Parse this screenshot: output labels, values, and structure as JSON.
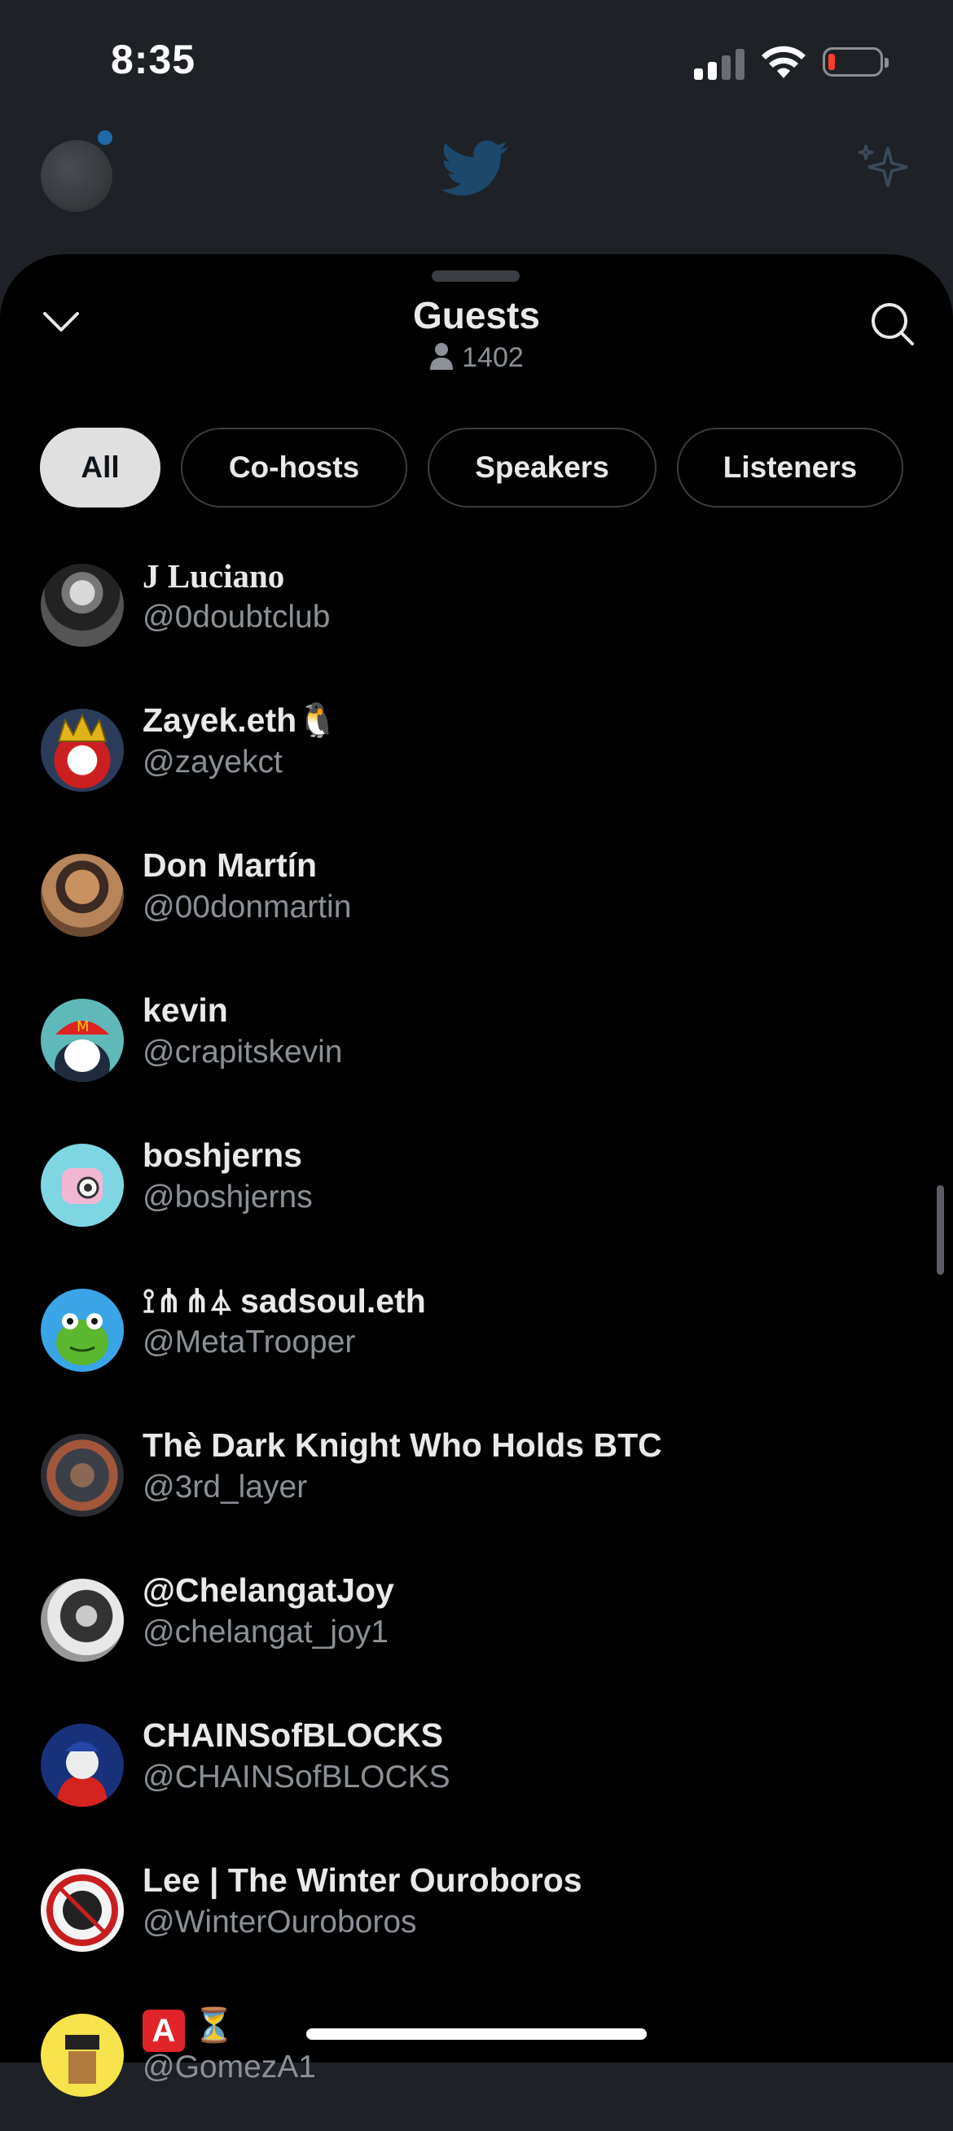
{
  "status_bar": {
    "time": "8:35"
  },
  "sheet": {
    "title": "Guests",
    "guest_count": "1402",
    "filters": [
      {
        "label": "All",
        "active": true
      },
      {
        "label": "Co-hosts",
        "active": false
      },
      {
        "label": "Speakers",
        "active": false
      },
      {
        "label": "Listeners",
        "active": false
      }
    ]
  },
  "guests": [
    {
      "name": "J Luciano",
      "handle": "@0doubtclub"
    },
    {
      "name": "Zayek.eth🐧",
      "handle": "@zayekct"
    },
    {
      "name": "Don Martín",
      "handle": "@00donmartin"
    },
    {
      "name": "kevin",
      "handle": "@crapitskevin"
    },
    {
      "name": "boshjerns",
      "handle": "@boshjerns"
    },
    {
      "name": "⟟⋔⋔⏃ sadsoul.eth",
      "handle": "@MetaTrooper"
    },
    {
      "name": "Thè Dark Knight Who Holds BTC",
      "handle": "@3rd_layer"
    },
    {
      "name": "@ChelangatJoy",
      "handle": "@chelangat_joy1"
    },
    {
      "name": "CHAINSofBLOCKS",
      "handle": "@CHAINSofBLOCKS"
    },
    {
      "name": "Lee | The Winter Ouroboros",
      "handle": "@WinterOuroboros"
    },
    {
      "name": "⏳",
      "handle": "@GomezA1"
    }
  ],
  "icons": {
    "collapse": "chevron-down-icon",
    "search": "search-icon",
    "person": "person-icon",
    "twitter": "twitter-bird-icon",
    "sparkle": "sparkle-icon"
  },
  "colors": {
    "sheet_background": "#000000",
    "active_chip": "#e0e0e0",
    "secondary_text": "#8b9096"
  }
}
